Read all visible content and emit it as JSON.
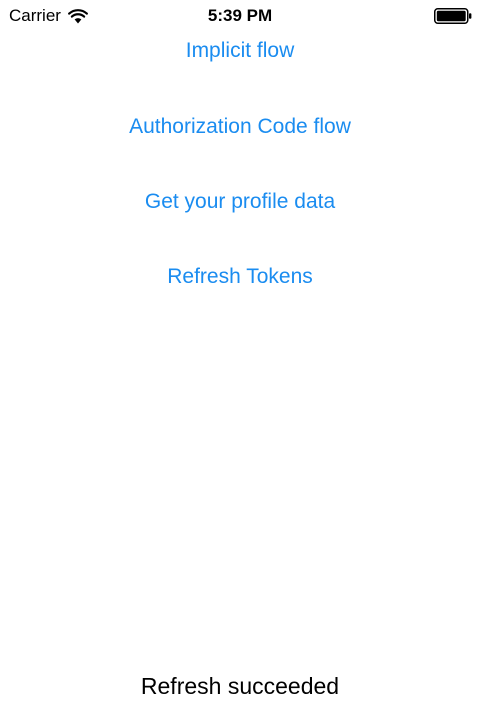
{
  "status_bar": {
    "carrier": "Carrier",
    "time": "5:39 PM",
    "wifi_icon": "wifi-icon",
    "battery_icon": "battery-full-icon"
  },
  "colors": {
    "link": "#1a8cf0",
    "text": "#000000",
    "background": "#ffffff"
  },
  "menu": {
    "items": [
      {
        "label": "Implicit flow"
      },
      {
        "label": "Authorization Code flow"
      },
      {
        "label": "Get your profile data"
      },
      {
        "label": "Refresh Tokens"
      }
    ]
  },
  "status_message": "Refresh succeeded"
}
